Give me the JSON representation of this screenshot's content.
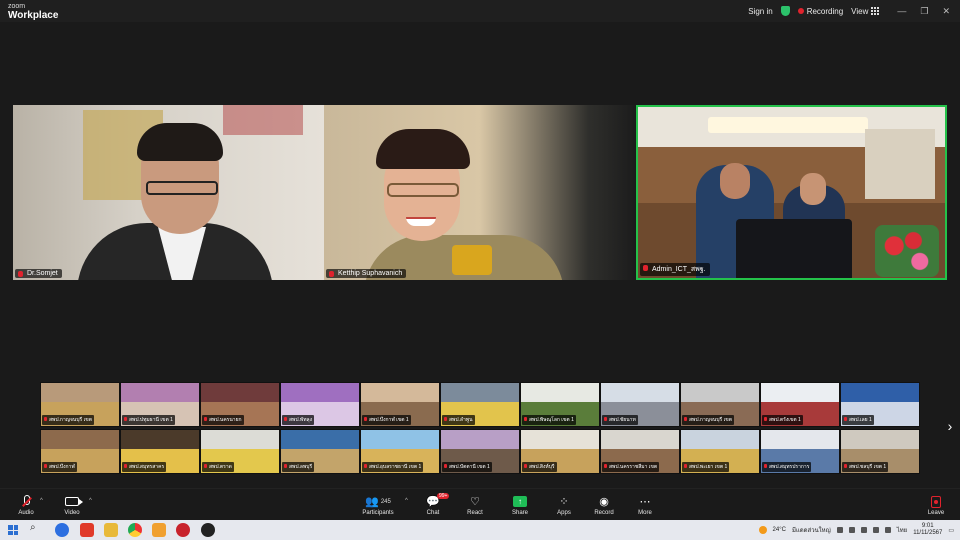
{
  "titlebar": {
    "brand_line1": "zoom",
    "brand_line2": "Workplace",
    "sign_in": "Sign in",
    "recording": "Recording",
    "view": "View"
  },
  "speakers": [
    {
      "name": "Dr.Somjet"
    },
    {
      "name": "Ketthip Suphavanich"
    },
    {
      "name": "Admin_ICT_สพฐ."
    }
  ],
  "gallery": {
    "row1": [
      {
        "name": "สพป.กาญจนบุรี เขต",
        "sky": "#b89a7a",
        "floor": "#c7a25c"
      },
      {
        "name": "สพป.ปทุมธานี เขต 1",
        "sky": "#b27fb0",
        "floor": "#d6c3b4"
      },
      {
        "name": "สพป.นครนายก",
        "sky": "#6f3b3b",
        "floor": "#a67555"
      },
      {
        "name": "สพป.พัทลุง",
        "sky": "#9f6fc0",
        "floor": "#dcc7e5"
      },
      {
        "name": "สพป.บึงกาฬ เขต 1",
        "sky": "#d4b99a",
        "floor": "#8a6b4f"
      },
      {
        "name": "สพป.ลำพูน",
        "sky": "#7c8b9b",
        "floor": "#e2c44c"
      },
      {
        "name": "สพป.พิษณุโลก เขต 1",
        "sky": "#e7e9e3",
        "floor": "#5a7d3a"
      },
      {
        "name": "สพป.ชัยนาท",
        "sky": "#d6dde6",
        "floor": "#8b8f99"
      },
      {
        "name": "สพป.กาญจนบุรี เขต",
        "sky": "#c9c9c9",
        "floor": "#8a6b55"
      },
      {
        "name": "สพป.ตรังเขต 1",
        "sky": "#ebeef2",
        "floor": "#a83a3a"
      },
      {
        "name": "สพป.เลย 1",
        "sky": "#2f5fa8",
        "floor": "#cdd6e6"
      }
    ],
    "row2": [
      {
        "name": "สพป.บึงกาฬ",
        "sky": "#8d6a4c",
        "floor": "#c7a25c"
      },
      {
        "name": "สพป.สมุทรสาคร",
        "sky": "#4b3a2a",
        "floor": "#e4c04a"
      },
      {
        "name": "สพป.ตราด",
        "sky": "#dcdcd6",
        "floor": "#e3c84d"
      },
      {
        "name": "สพป.ลพบุรี",
        "sky": "#3a6ea8",
        "floor": "#c3a46a"
      },
      {
        "name": "สพป.อุบลราชธานี เขต 1",
        "sky": "#8fc2e6",
        "floor": "#d8b35a"
      },
      {
        "name": "สพป.ปัตตานี เขต 1",
        "sky": "#b89fc6",
        "floor": "#6e5a4a"
      },
      {
        "name": "สพป.สิงห์บุรี",
        "sky": "#e6e2d8",
        "floor": "#c7a25c"
      },
      {
        "name": "สพป.นครราชสีมา เขต",
        "sky": "#d9d6cf",
        "floor": "#8c6a4d"
      },
      {
        "name": "สพป.พะเยา เขต 1",
        "sky": "#c9d3de",
        "floor": "#d3b052"
      },
      {
        "name": "สพป.สมุทรปราการ",
        "sky": "#e4e7ec",
        "floor": "#5a7aa8"
      },
      {
        "name": "สพป.ชลบุรี เขต 1",
        "sky": "#cfc9bf",
        "floor": "#a88e6a"
      }
    ],
    "next_label": "›"
  },
  "toolbar": {
    "audio": "Audio",
    "video": "Video",
    "participants": "Participants",
    "participants_count": "245",
    "chat": "Chat",
    "chat_badge": "99+",
    "react": "React",
    "share": "Share",
    "apps": "Apps",
    "record": "Record",
    "more": "More",
    "leave": "Leave"
  },
  "taskbar": {
    "weather": "24°C",
    "weather_desc": "มีแดดส่วนใหญ่",
    "lang": "ไทย",
    "time": "9:01",
    "date": "11/11/2567"
  },
  "colors": {
    "accent_green": "#24c24a",
    "record_red": "#e0232d"
  }
}
